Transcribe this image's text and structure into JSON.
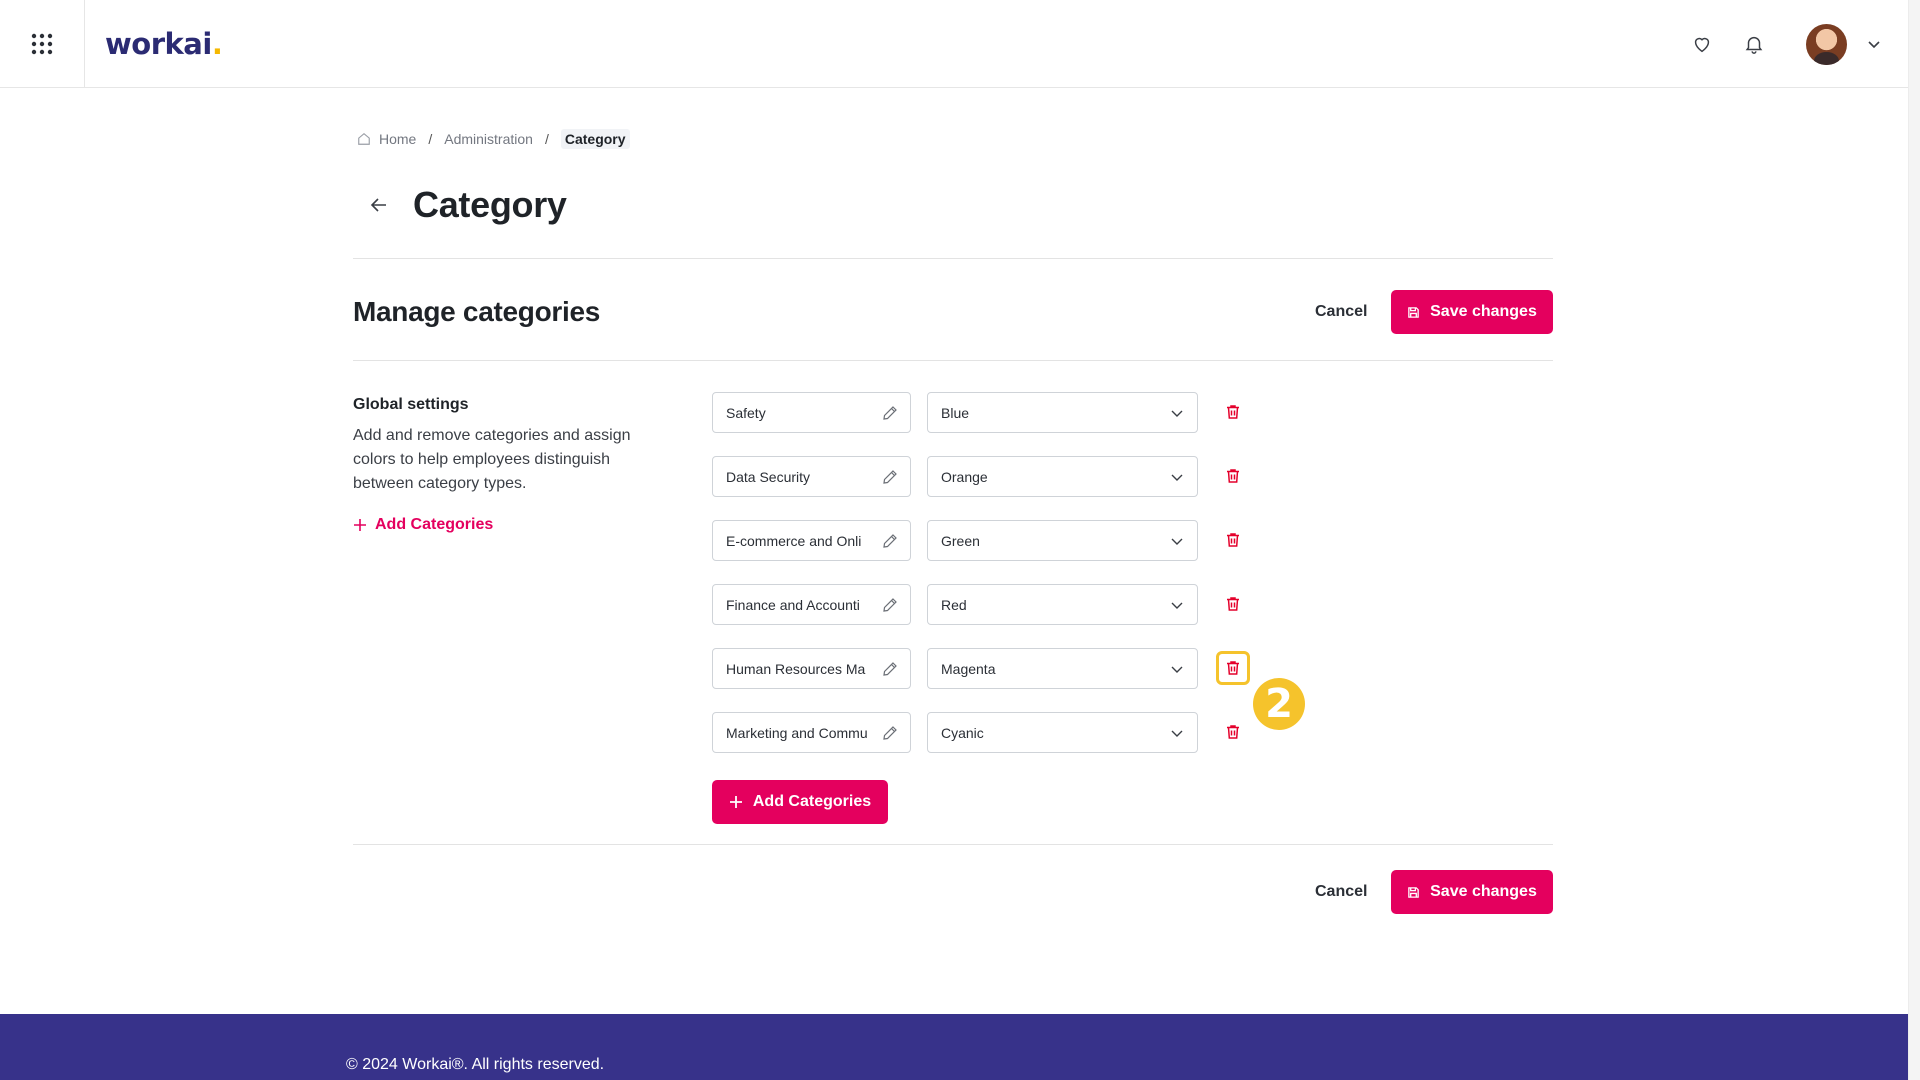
{
  "header": {
    "logo_text": "workai",
    "logo_dot": ".",
    "icons": [
      "apps-grid-icon",
      "heart-icon",
      "bell-icon",
      "chevron-down-icon"
    ]
  },
  "breadcrumb": {
    "home": "Home",
    "separator": "/",
    "admin": "Administration",
    "current": "Category"
  },
  "page": {
    "title": "Category"
  },
  "section": {
    "title": "Manage categories",
    "cancel_label": "Cancel",
    "save_label": "Save changes"
  },
  "global_settings": {
    "title": "Global settings",
    "description": "Add and remove categories and assign colors to help employees distinguish between category types.",
    "add_link_label": "Add Categories"
  },
  "categories": [
    {
      "name": "Safety",
      "color": "Blue"
    },
    {
      "name": "Data Security",
      "color": "Orange"
    },
    {
      "name": "E-commerce and Onli",
      "color": "Green"
    },
    {
      "name": "Finance and Accounti",
      "color": "Red"
    },
    {
      "name": "Human Resources Ma",
      "color": "Magenta"
    },
    {
      "name": "Marketing and Commu",
      "color": "Cyanic"
    }
  ],
  "add_button_label": "Add Categories",
  "step_badge": "2",
  "footer": {
    "copyright": "© 2024 Workai®. All rights reserved."
  },
  "colors": {
    "primary": "#e4005e",
    "brand": "#2b2b73",
    "accent_yellow": "#f5c32c",
    "footer_bg": "#37328a"
  }
}
